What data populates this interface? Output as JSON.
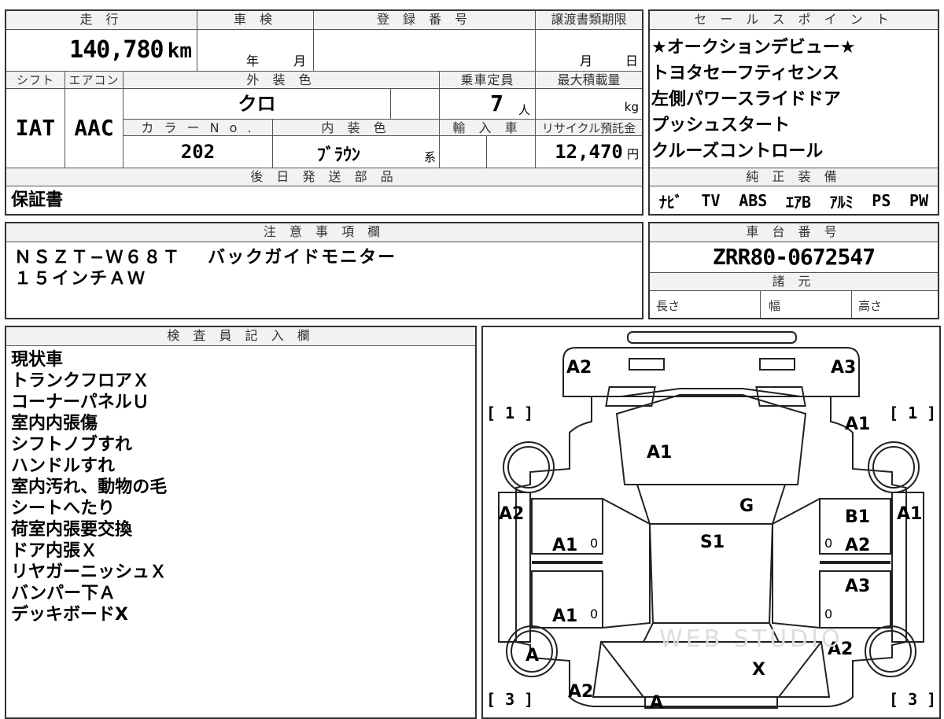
{
  "mileage": {
    "label": "走 行",
    "value": "140,780",
    "unit": "km"
  },
  "inspection": {
    "label": "車 検",
    "year_unit": "年",
    "month_unit": "月"
  },
  "registration": {
    "label": "登 録 番 号"
  },
  "transfer": {
    "label": "譲渡書類期限",
    "month_unit": "月",
    "day_unit": "日"
  },
  "shift": {
    "label": "シフト",
    "value": "IAT"
  },
  "aircon": {
    "label": "エアコン",
    "value": "AAC"
  },
  "exterior_color": {
    "label": "外 装 色",
    "value": "クロ"
  },
  "capacity": {
    "label": "乗車定員",
    "value": "7",
    "unit": "人"
  },
  "max_load": {
    "label": "最大積載量",
    "unit": "kg"
  },
  "color_no": {
    "label": "カ ラ ー N o .",
    "value": "202"
  },
  "interior_color": {
    "label": "内 装 色",
    "value": "ﾌﾞﾗｳﾝ",
    "suffix": "系"
  },
  "import_car": {
    "label": "輸 入 車"
  },
  "recycle": {
    "label": "リサイクル預託金",
    "value": "12,470",
    "unit": "円"
  },
  "later_parts": {
    "label": "後 日 発 送 部 品",
    "value": "保証書"
  },
  "sales_points": {
    "label": "セ ー ル ス ポ イ ン ト",
    "items": [
      "★オークションデビュー★",
      "トヨタセーフティセンス",
      "左側パワースライドドア",
      "プッシュスタート",
      "クルーズコントロール"
    ]
  },
  "equipment": {
    "label": "純 正 装 備",
    "items": [
      "ﾅﾋﾞ",
      "TV",
      "ABS",
      "ｴｱB",
      "ｱﾙﾐ",
      "PS",
      "PW"
    ]
  },
  "notes": {
    "label": "注 意 事 項 欄",
    "lines": [
      "ＮＳＺＴ−Ｗ６８Ｔ　 バックガイドモニター",
      "１５インチＡＷ"
    ]
  },
  "chassis": {
    "label": "車 台 番 号",
    "value": "ZRR80-0672547"
  },
  "specs": {
    "label": "諸 元",
    "length": "長さ",
    "width": "幅",
    "height": "高さ"
  },
  "inspector": {
    "label": "検 査 員 記 入 欄",
    "lines": [
      "現状車",
      "トランクフロアＸ",
      "コーナーパネルＵ",
      "室内内張傷",
      "シフトノブすれ",
      "ハンドルすれ",
      "室内汚れ、動物の毛",
      "シートへたり",
      "荷室内張要交換",
      "ドア内張Ｘ",
      "リヤガーニッシュＸ",
      "バンパー下Ａ",
      "デッキボードX"
    ]
  },
  "diagram": {
    "marks": {
      "rear_left": "A2",
      "rear_right": "A3",
      "rear_bracket_left": "[ 1 ]",
      "rear_bracket_right": "[ 1 ]",
      "quarter_right": "A1",
      "back_glass": "A1",
      "side_left": "A2",
      "side_right": "A1",
      "roof": "G",
      "door_rl": "A1",
      "door_rl_zero": "0",
      "door_rr_top": "B1",
      "door_rr": "A2",
      "door_rr_zero": "0",
      "center": "S1",
      "door_fl": "A1",
      "door_fl_zero": "0",
      "door_fr": "A3",
      "door_fr_zero": "0",
      "wheel_fl": "A",
      "fender_fr": "A2",
      "hood": "X",
      "front_left": "A2",
      "front_bracket_left": "[ 3 ]",
      "front_bracket_right": "[ 3 ]",
      "bumper": "A"
    },
    "watermark": "WEB STUDIO"
  }
}
